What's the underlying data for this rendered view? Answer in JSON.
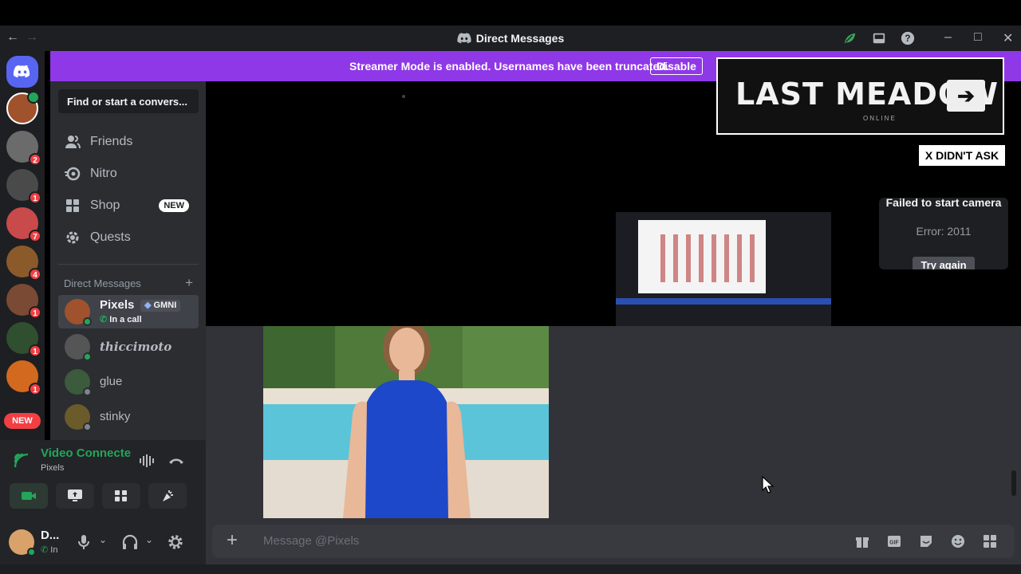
{
  "window": {
    "title": "Direct Messages"
  },
  "banner": {
    "message": "Streamer Mode is enabled. Usernames have been truncated.",
    "disable_label": "Disable"
  },
  "servers": {
    "badges": [
      "2",
      "1",
      "7",
      "4",
      "1",
      "1",
      "1"
    ],
    "new_label": "NEW"
  },
  "sidebar": {
    "search_placeholder": "Find or start a convers...",
    "nav": [
      {
        "label": "Friends",
        "icon": "friends-icon"
      },
      {
        "label": "Nitro",
        "icon": "nitro-icon"
      },
      {
        "label": "Shop",
        "icon": "shop-icon",
        "tag": "NEW"
      },
      {
        "label": "Quests",
        "icon": "quests-icon"
      }
    ],
    "dm_header": "Direct Messages",
    "dms": [
      {
        "name": "Pixels",
        "tag": "GMNI",
        "subtitle": "In a call",
        "status": "online"
      },
      {
        "name": "thiccimoto",
        "status": "online"
      },
      {
        "name": "glue",
        "status": "offline"
      },
      {
        "name": "stinky",
        "status": "offline"
      }
    ]
  },
  "voice": {
    "status": "Video Connecte",
    "channel": "Pixels"
  },
  "user": {
    "name": "D...",
    "status": "In"
  },
  "overlay": {
    "last_meadow": "LAST MEADOW",
    "last_meadow_sub": "ONLINE",
    "didnt_ask": "X DIDN'T ASK",
    "camera_error_title": "Failed to start camera",
    "camera_error_code": "Error: 2011",
    "try_again": "Try again"
  },
  "composer": {
    "placeholder": "Message @Pixels"
  },
  "colors": {
    "accent": "#5865f2",
    "banner": "#8f38e8",
    "online": "#23a55a",
    "danger": "#f23f43"
  }
}
